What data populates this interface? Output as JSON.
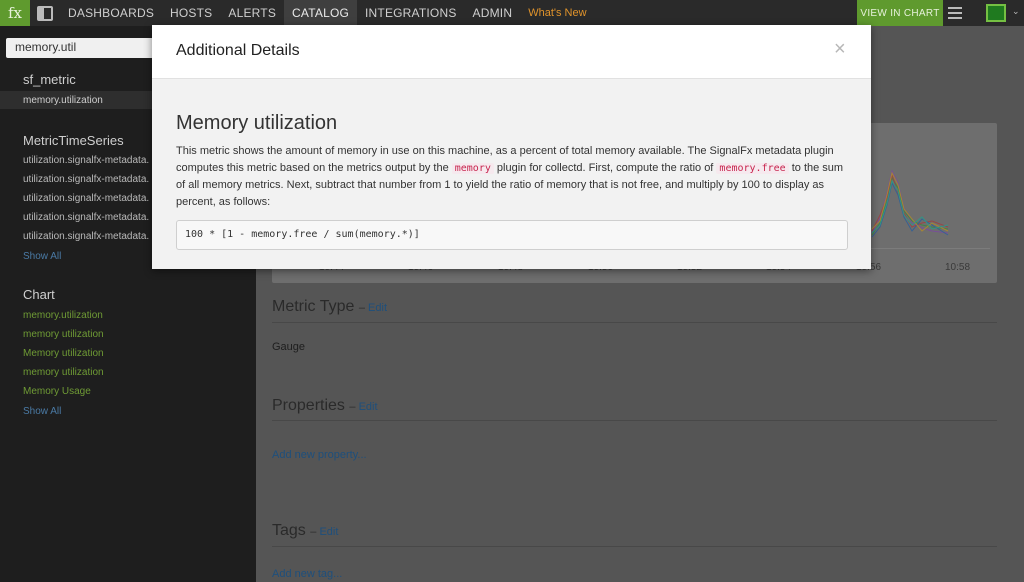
{
  "topnav": {
    "logo": "fx",
    "items": [
      "DASHBOARDS",
      "HOSTS",
      "ALERTS",
      "CATALOG",
      "INTEGRATIONS",
      "ADMIN"
    ],
    "active": "CATALOG",
    "whats_new": "What's New",
    "view_in_chart": "VIEW IN CHART"
  },
  "sidebar": {
    "search_value": "memory.util",
    "sections": [
      {
        "title": "sf_metric",
        "items": [
          "memory.utilization"
        ]
      },
      {
        "title": "MetricTimeSeries",
        "items": [
          "utilization.signalfx-metadata.",
          "utilization.signalfx-metadata.",
          "utilization.signalfx-metadata.",
          "utilization.signalfx-metadata.",
          "utilization.signalfx-metadata."
        ],
        "show_all": "Show All"
      },
      {
        "title": "Chart",
        "items": [
          "memory.utilization",
          "memory utilization",
          "Memory utilization",
          "memory utilization",
          "Memory Usage"
        ],
        "show_all": "Show All"
      }
    ]
  },
  "main": {
    "chart_ticks": [
      "10:44",
      "10:46",
      "10:48",
      "10:50",
      "10:52",
      "10:54",
      "10:56",
      "10:58"
    ],
    "metric_type": {
      "title": "Metric Type",
      "edit": "Edit",
      "value": "Gauge"
    },
    "properties": {
      "title": "Properties",
      "edit": "Edit",
      "add": "Add new property..."
    },
    "tags": {
      "title": "Tags",
      "edit": "Edit",
      "add": "Add new tag..."
    }
  },
  "modal": {
    "title": "Additional Details",
    "close": "×",
    "heading": "Memory utilization",
    "desc_parts": {
      "p1": "This metric shows the amount of memory in use on this machine, as a percent of total memory available. The SignalFx metadata plugin computes this metric based on the metrics output by the ",
      "code1": "memory",
      "p2": " plugin for collectd. First, compute the ratio of ",
      "code2": "memory.free",
      "p3": " to the sum of all memory metrics. Next, subtract that number from 1 to yield the ratio of memory that is not free, and multiply by 100 to display as percent, as follows:"
    },
    "formula": "100 * [1 - memory.free / sum(memory.*)]"
  },
  "colors": {
    "accent_green": "#5f9a2e",
    "link_blue": "#1e4f7c",
    "code_pink": "#c7254e",
    "whats_new_orange": "#e0932b"
  }
}
